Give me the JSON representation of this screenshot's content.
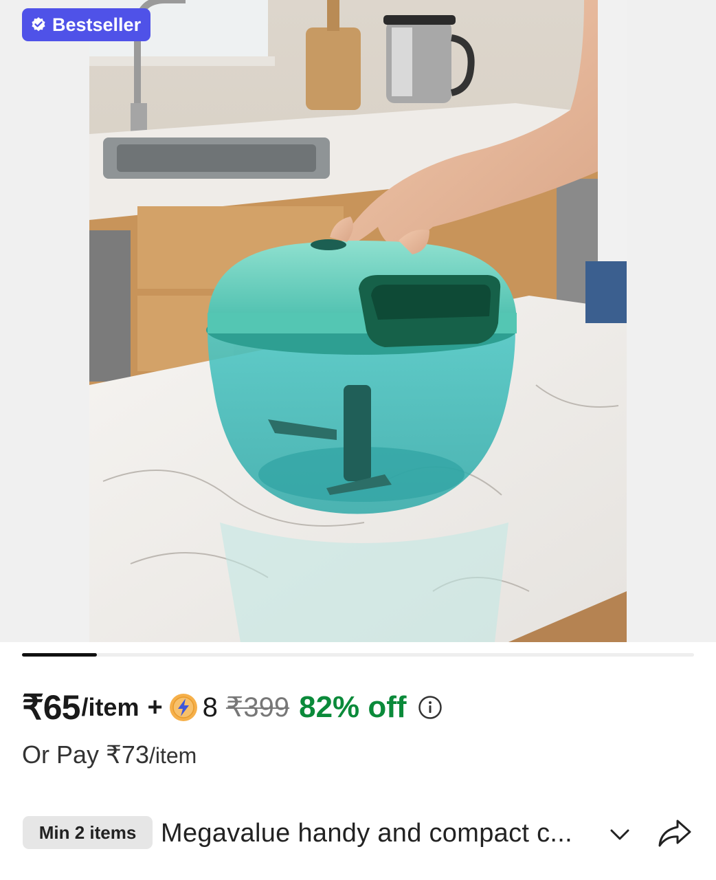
{
  "badge": {
    "label": "Bestseller",
    "icon": "verified-check-icon",
    "color": "#4f52e8"
  },
  "carousel": {
    "active_index": 0,
    "total": 9
  },
  "price": {
    "amount": "₹65",
    "unit": "/item",
    "plus": "+",
    "coin_icon": "lightning-coin-icon",
    "coins": "8",
    "mrp": "₹399",
    "discount": "82% off",
    "discount_color": "#0b8a3a"
  },
  "alt_price": {
    "prefix": "Or Pay ₹73",
    "unit": "/item"
  },
  "min_items": "Min 2 items",
  "title": "Megavalue handy and compact c...",
  "icons": {
    "info": "info-icon",
    "expand": "chevron-down-icon",
    "share": "share-icon"
  }
}
